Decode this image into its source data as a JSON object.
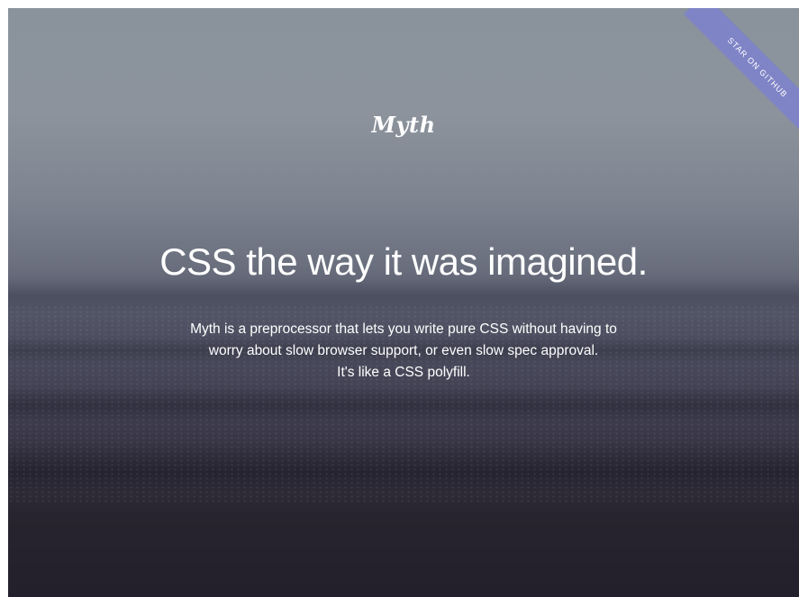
{
  "logo": {
    "text": "Myth"
  },
  "hero": {
    "headline": "CSS the way it was imagined.",
    "description_lines": [
      "Myth is a preprocessor that lets you write pure CSS without having to",
      "worry about slow browser support, or even slow spec approval.",
      "It's like a CSS polyfill."
    ]
  },
  "ribbon": {
    "label": "STAR ON GITHUB",
    "color": "#7f84c6"
  },
  "colors": {
    "sky": "#8a939c",
    "sea_dark": "#221f2c",
    "text": "#ffffff"
  }
}
